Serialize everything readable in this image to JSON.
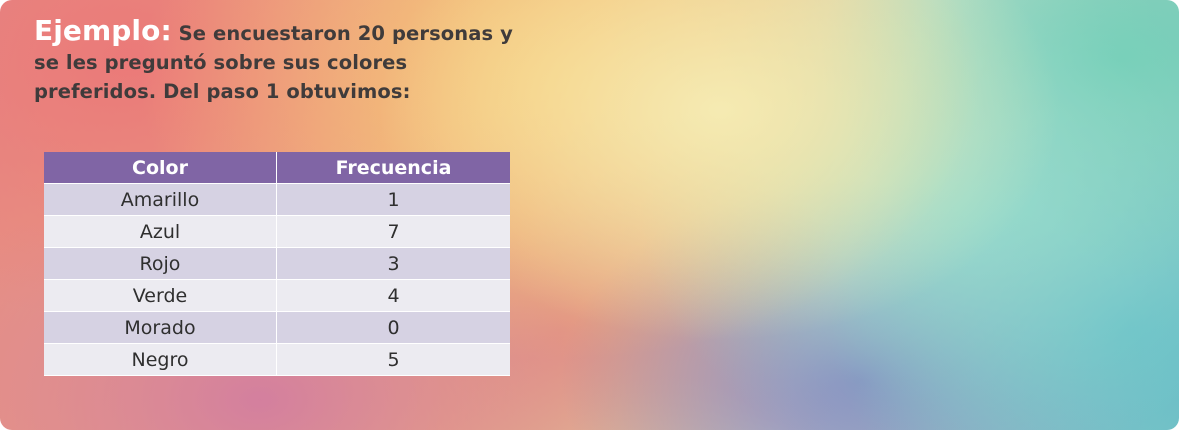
{
  "heading": {
    "lead": "Ejemplo:",
    "text": " Se encuestaron 20 personas y se les preguntó sobre sus colores preferidos. Del paso 1 obtuvimos:"
  },
  "table": {
    "headers": [
      "Color",
      "Frecuencia"
    ],
    "rows": [
      {
        "color": "Amarillo",
        "freq": "1"
      },
      {
        "color": "Azul",
        "freq": "7"
      },
      {
        "color": "Rojo",
        "freq": "3"
      },
      {
        "color": "Verde",
        "freq": "4"
      },
      {
        "color": "Morado",
        "freq": "0"
      },
      {
        "color": "Negro",
        "freq": "5"
      }
    ]
  },
  "colors": {
    "header_bg": "#8065a5",
    "row_odd": "#d6d2e3",
    "row_even": "#ecebf1",
    "heading_lead": "#ffffff",
    "heading_text": "#3f3b3b"
  }
}
